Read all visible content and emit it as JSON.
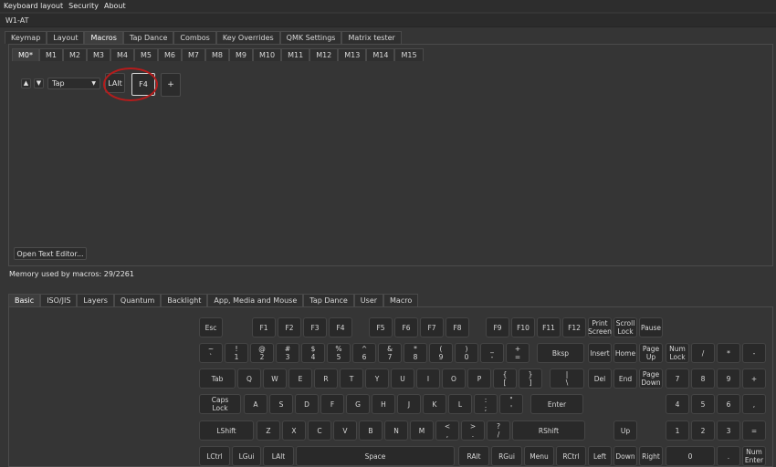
{
  "menu": [
    "Keyboard layout",
    "Security",
    "About"
  ],
  "device_title": "W1-AT",
  "top_tabs": [
    "Keymap",
    "Layout",
    "Macros",
    "Tap Dance",
    "Combos",
    "Key Overrides",
    "QMK Settings",
    "Matrix tester"
  ],
  "top_tab_selected": "Macros",
  "macro_tabs": [
    "M0*",
    "M1",
    "M2",
    "M3",
    "M4",
    "M5",
    "M6",
    "M7",
    "M8",
    "M9",
    "M10",
    "M11",
    "M12",
    "M13",
    "M14",
    "M15"
  ],
  "macro_tab_selected": "M0*",
  "macro_row": {
    "up": "▲",
    "down": "▼",
    "action_value": "Tap",
    "keys": [
      "LAlt",
      "F4"
    ],
    "add_label": "+"
  },
  "open_text_editor": "Open Text Editor...",
  "memory_status": "Memory used by macros: 29/2261",
  "bottom_tabs": [
    "Basic",
    "ISO/JIS",
    "Layers",
    "Quantum",
    "Backlight",
    "App, Media and Mouse",
    "Tap Dance",
    "User",
    "Macro"
  ],
  "bottom_tab_selected": "Basic",
  "annotation_color": "#b51c1c",
  "keyboard": {
    "fn_row": [
      "Esc",
      "F1",
      "F2",
      "F3",
      "F4",
      "F5",
      "F6",
      "F7",
      "F8",
      "F9",
      "F10",
      "F11",
      "F12",
      "Print\nScreen",
      "Scroll\nLock",
      "Pause"
    ],
    "num_row": [
      "~\n`",
      "!\n1",
      "@\n2",
      "#\n3",
      "$\n4",
      "%\n5",
      "^\n6",
      "&\n7",
      "*\n8",
      "(\n9",
      ")\n0",
      "_\n-",
      "+\n=",
      "Bksp",
      "Insert",
      "Home",
      "Page\nUp",
      "Num\nLock",
      "/",
      "*",
      "-"
    ],
    "tab_row": [
      "Tab",
      "Q",
      "W",
      "E",
      "R",
      "T",
      "Y",
      "U",
      "I",
      "O",
      "P",
      "{\n[",
      "}\n]",
      "|\n\\",
      "Del",
      "End",
      "Page\nDown",
      "7",
      "8",
      "9",
      "+"
    ],
    "caps_row": [
      "Caps\nLock",
      "A",
      "S",
      "D",
      "F",
      "G",
      "H",
      "J",
      "K",
      "L",
      ":\n;",
      "\"\n'",
      "Enter",
      "4",
      "5",
      "6",
      ","
    ],
    "shift_row": [
      "LShift",
      "Z",
      "X",
      "C",
      "V",
      "B",
      "N",
      "M",
      "<\n,",
      ">\n.",
      "?\n/",
      "RShift",
      "Up",
      "1",
      "2",
      "3",
      "="
    ],
    "ctrl_row": [
      "LCtrl",
      "LGui",
      "LAlt",
      "Space",
      "RAlt",
      "RGui",
      "Menu",
      "RCtrl",
      "Left",
      "Down",
      "Right",
      "0",
      ".",
      "Num\nEnter"
    ]
  }
}
